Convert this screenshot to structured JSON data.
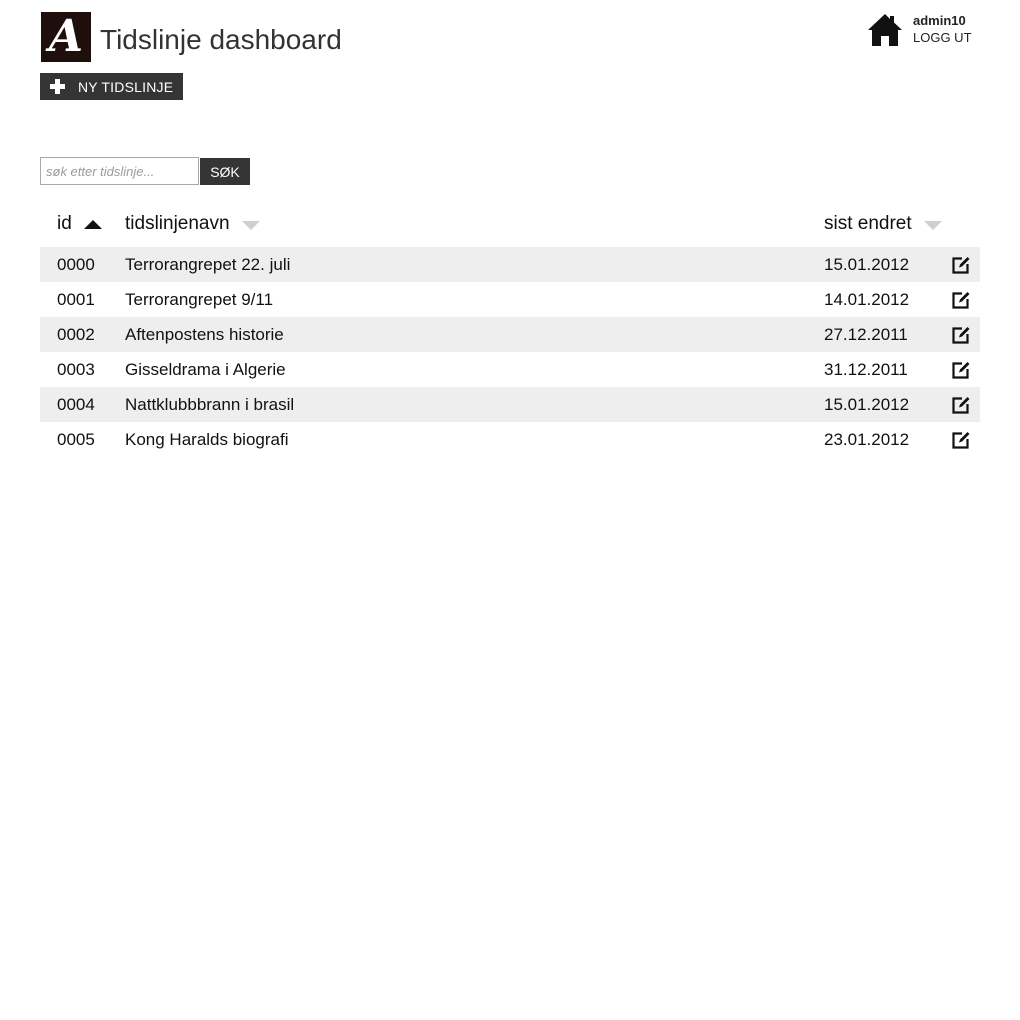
{
  "header": {
    "logo_letter": "A",
    "title": "Tidslinje dashboard",
    "new_button_label": "NY TIDSLINJE"
  },
  "user": {
    "username": "admin10",
    "logout_label": "LOGG UT"
  },
  "search": {
    "placeholder": "søk etter tidslinje...",
    "button_label": "SØK"
  },
  "table": {
    "columns": {
      "id": "id",
      "name": "tidslinjenavn",
      "modified": "sist endret"
    },
    "rows": [
      {
        "id": "0000",
        "name": "Terrorangrepet 22. juli",
        "modified": "15.01.2012"
      },
      {
        "id": "0001",
        "name": "Terrorangrepet 9/11",
        "modified": "14.01.2012"
      },
      {
        "id": "0002",
        "name": "Aftenpostens historie",
        "modified": "27.12.2011"
      },
      {
        "id": "0003",
        "name": "Gisseldrama i Algerie",
        "modified": "31.12.2011"
      },
      {
        "id": "0004",
        "name": "Nattklubbbrann i brasil",
        "modified": "15.01.2012"
      },
      {
        "id": "0005",
        "name": "Kong Haralds biografi",
        "modified": "23.01.2012"
      }
    ]
  },
  "colors": {
    "button_bg": "#353535",
    "row_shade": "#eeeeee",
    "logo_bg": "#1e0f0c"
  }
}
